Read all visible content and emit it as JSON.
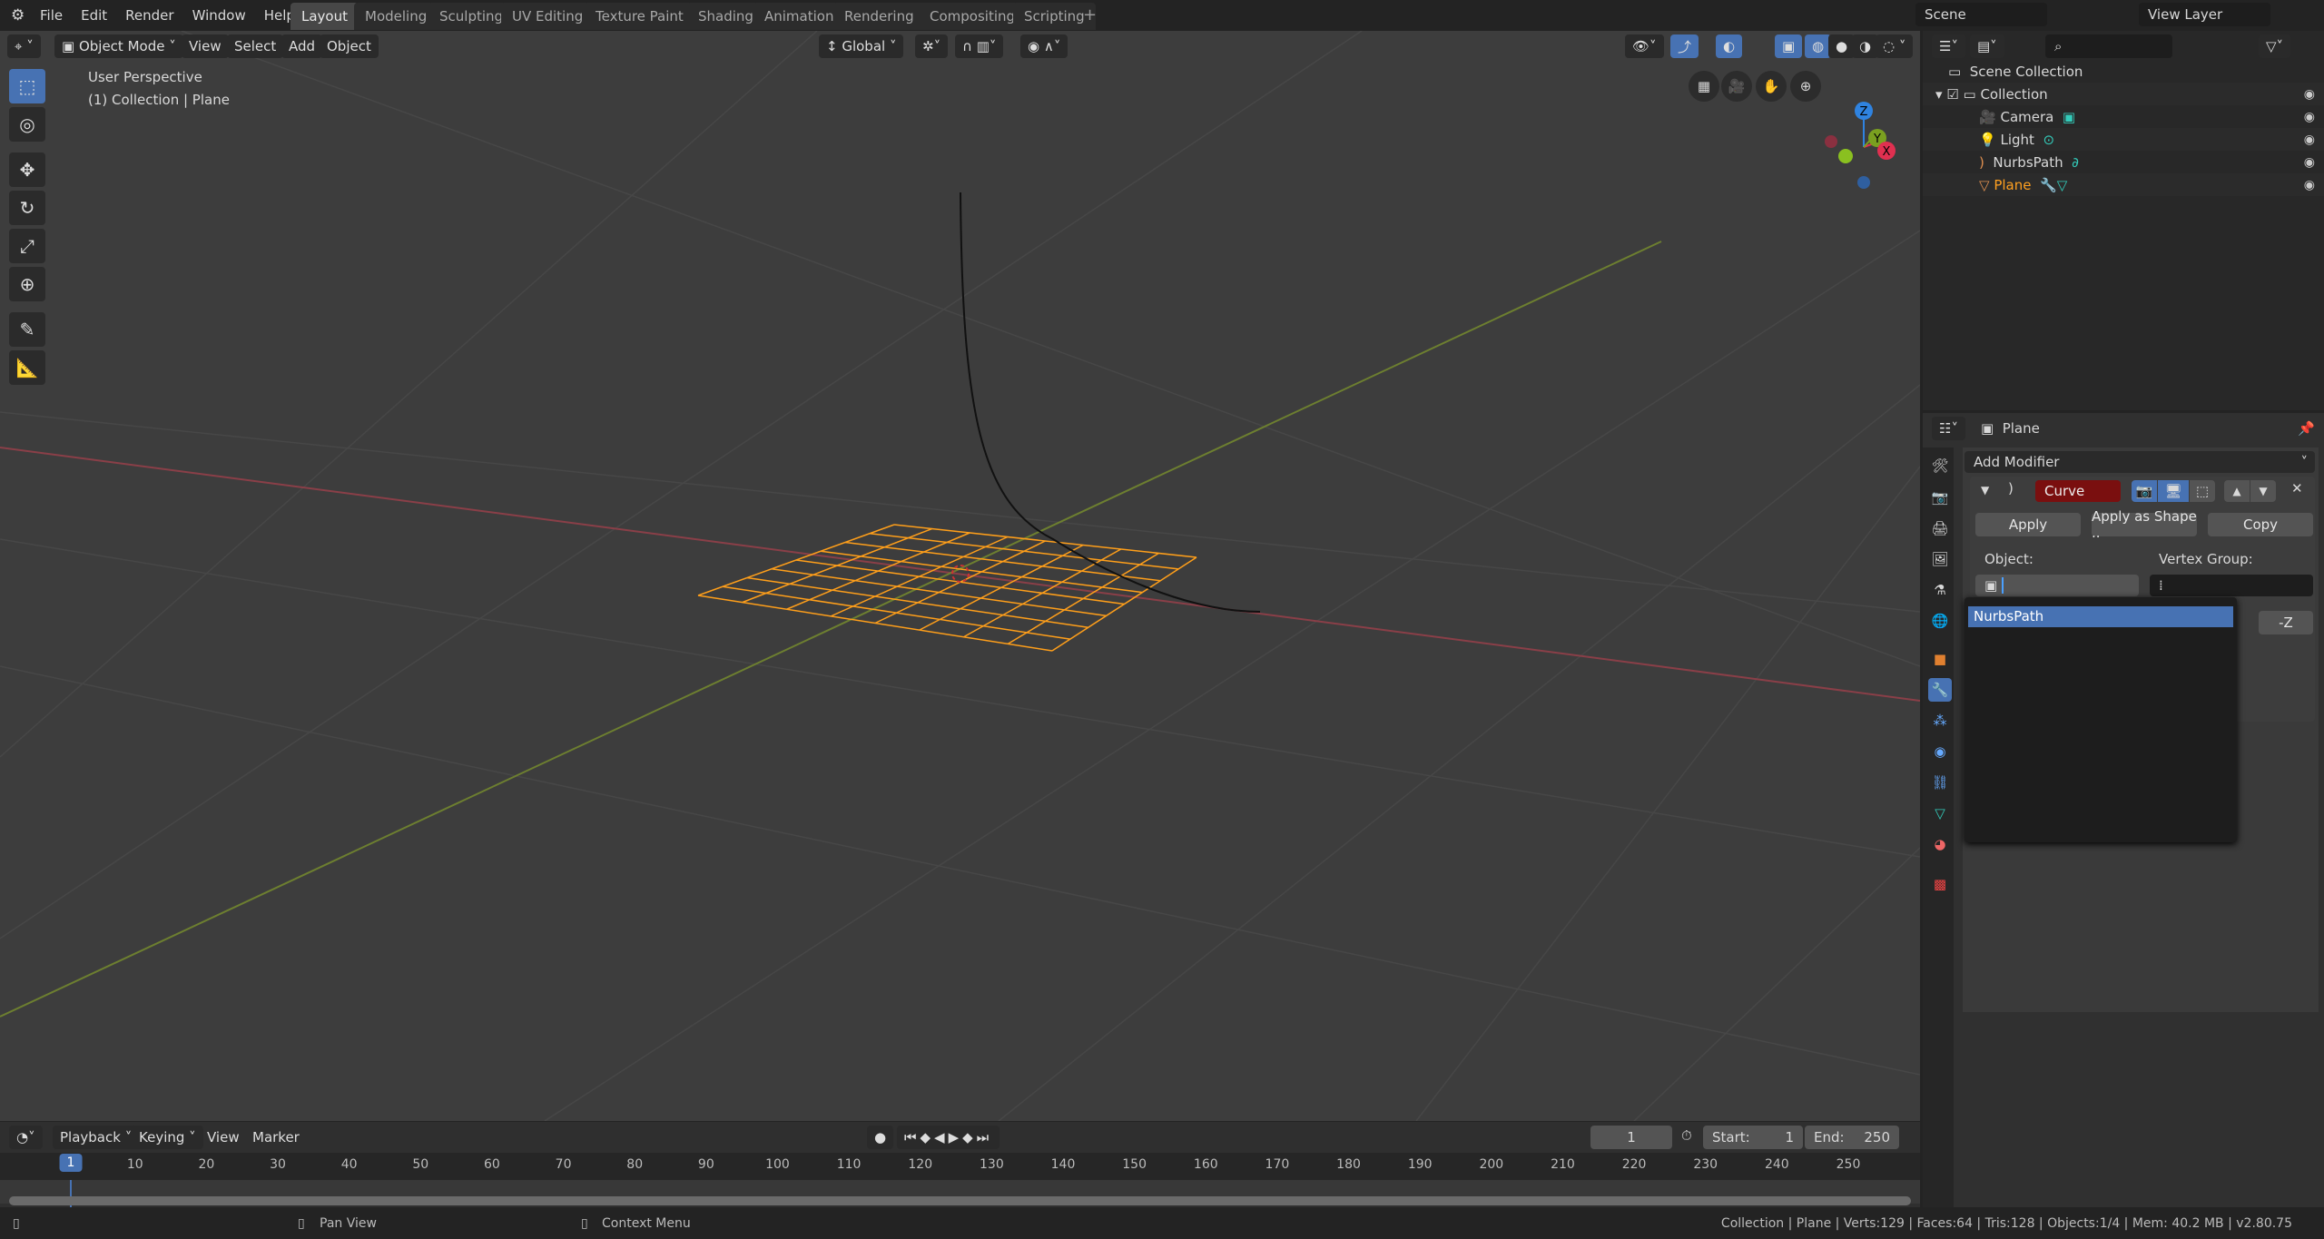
{
  "menu": [
    "File",
    "Edit",
    "Render",
    "Window",
    "Help"
  ],
  "workspaces": [
    "Layout",
    "Modeling",
    "Sculpting",
    "UV Editing",
    "Texture Paint",
    "Shading",
    "Animation",
    "Rendering",
    "Compositing",
    "Scripting"
  ],
  "active_workspace": "Layout",
  "scene": "Scene",
  "view_layer": "View Layer",
  "viewport": {
    "mode": "Object Mode",
    "menus": [
      "View",
      "Select",
      "Add",
      "Object"
    ],
    "orientation": "Global",
    "overlay_line1": "User Perspective",
    "overlay_line2": "(1) Collection | Plane",
    "gizmo": {
      "z": "Z",
      "y": "Y",
      "x": "X"
    }
  },
  "outliner": {
    "root": "Scene Collection",
    "collection": "Collection",
    "items": [
      {
        "name": "Camera",
        "selected": false
      },
      {
        "name": "Light",
        "selected": false
      },
      {
        "name": "NurbsPath",
        "selected": false
      },
      {
        "name": "Plane",
        "selected": true
      }
    ]
  },
  "properties": {
    "object": "Plane",
    "add_modifier": "Add Modifier",
    "modifier_name": "Curve",
    "apply": "Apply",
    "apply_shape": "Apply as Shape ..",
    "copy": "Copy",
    "object_label": "Object:",
    "vertex_group_label": "Vertex Group:",
    "axis_visible": "-Z",
    "dropdown_items": [
      "NurbsPath"
    ]
  },
  "timeline": {
    "menus": [
      "Playback",
      "Keying",
      "View",
      "Marker"
    ],
    "current_frame": "1",
    "start_label": "Start:",
    "start": "1",
    "end_label": "End:",
    "end": "250",
    "ticks": [
      "1",
      "10",
      "20",
      "30",
      "40",
      "50",
      "60",
      "70",
      "80",
      "90",
      "100",
      "110",
      "120",
      "130",
      "140",
      "150",
      "160",
      "170",
      "180",
      "190",
      "200",
      "210",
      "220",
      "230",
      "240",
      "250"
    ]
  },
  "status": {
    "pan": "Pan View",
    "context": "Context Menu",
    "info": "Collection | Plane | Verts:129 | Faces:64 | Tris:128 | Objects:1/4 | Mem: 40.2 MB | v2.80.75"
  },
  "colors": {
    "accent": "#4772b3",
    "selected": "#ffa020",
    "x_axis": "#a8404f",
    "y_axis": "#7a9a30",
    "modifier": "#7a0f0f"
  }
}
